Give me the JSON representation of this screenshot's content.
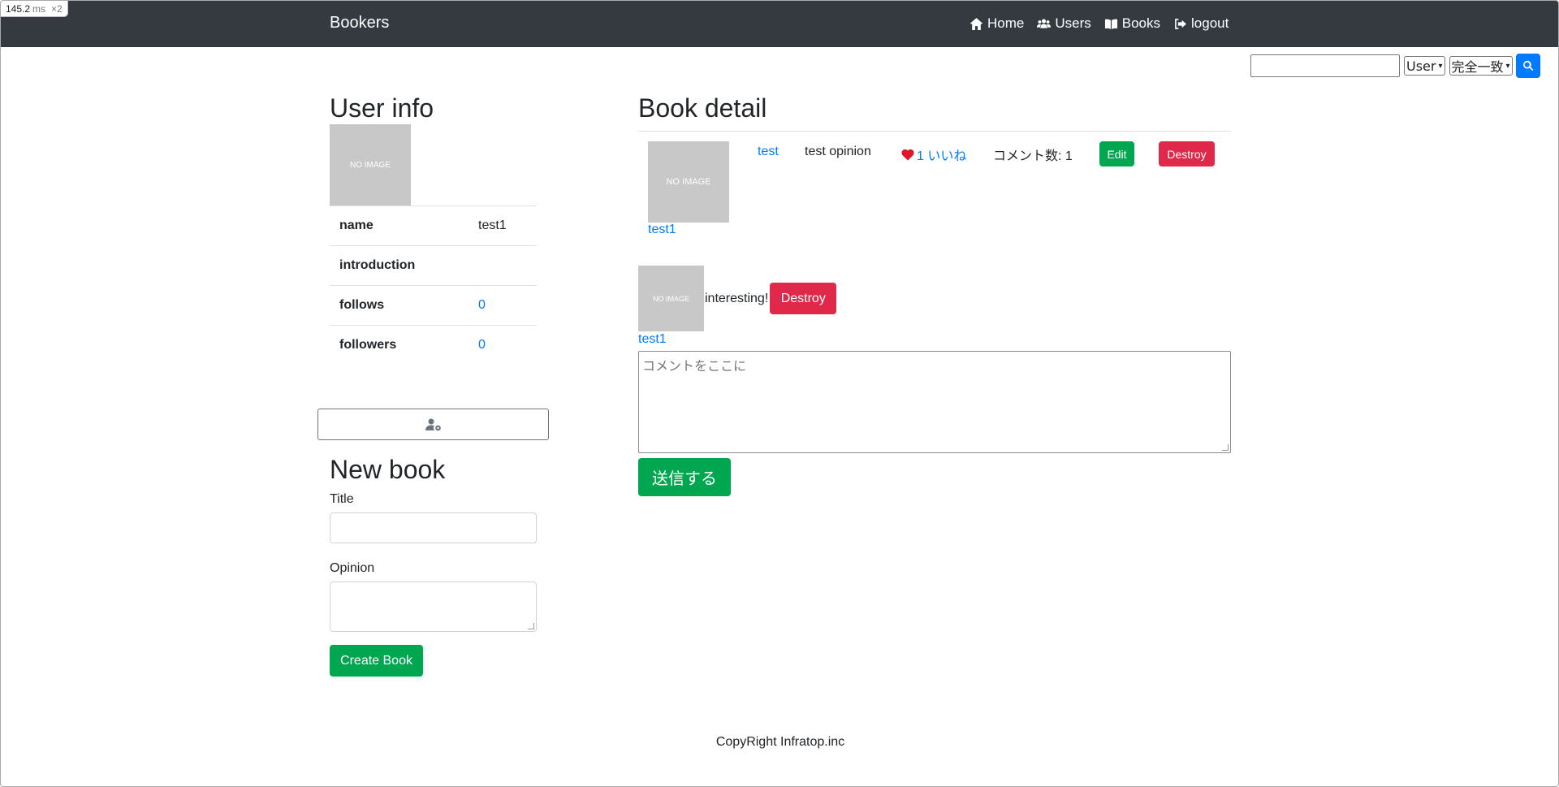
{
  "perf_badge": {
    "value": "145.2",
    "unit": "ms",
    "multiplier": "×2"
  },
  "navbar": {
    "brand": "Bookers",
    "links": [
      {
        "label": "Home",
        "icon": "home-icon"
      },
      {
        "label": "Users",
        "icon": "users-icon"
      },
      {
        "label": "Books",
        "icon": "book-open-icon"
      },
      {
        "label": "logout",
        "icon": "sign-out-icon"
      }
    ]
  },
  "search": {
    "input_value": "",
    "target_selected": "User",
    "match_selected": "完全一致",
    "button_icon": "search-icon"
  },
  "user_info": {
    "heading": "User info",
    "avatar_text": "NO IMAGE",
    "rows": [
      {
        "key": "name",
        "value": "test1"
      },
      {
        "key": "introduction",
        "value": ""
      },
      {
        "key": "follows",
        "value": "0"
      },
      {
        "key": "followers",
        "value": "0"
      }
    ],
    "settings_icon": "user-cog-icon"
  },
  "new_book": {
    "heading": "New book",
    "title_label": "Title",
    "title_value": "",
    "opinion_label": "Opinion",
    "opinion_value": "",
    "submit_label": "Create Book"
  },
  "book_detail": {
    "heading": "Book detail",
    "avatar_text": "NO IMAGE",
    "user_name": "test1",
    "title": "test",
    "opinion": "test opinion",
    "favorite_label": "1 いいね",
    "comment_count": "コメント数: 1",
    "edit_label": "Edit",
    "destroy_label": "Destroy"
  },
  "comments": {
    "items": [
      {
        "avatar_text": "NO IMAGE",
        "text": "interesting!",
        "destroy_label": "Destroy",
        "user": "test1"
      }
    ],
    "placeholder": "コメントをここに",
    "submit_label": "送信する"
  },
  "footer": {
    "text": "CopyRight Infratop.inc"
  },
  "colors": {
    "navbar": "#343a40",
    "link": "#007bff",
    "success": "#00a650",
    "danger": "#e0284a"
  }
}
